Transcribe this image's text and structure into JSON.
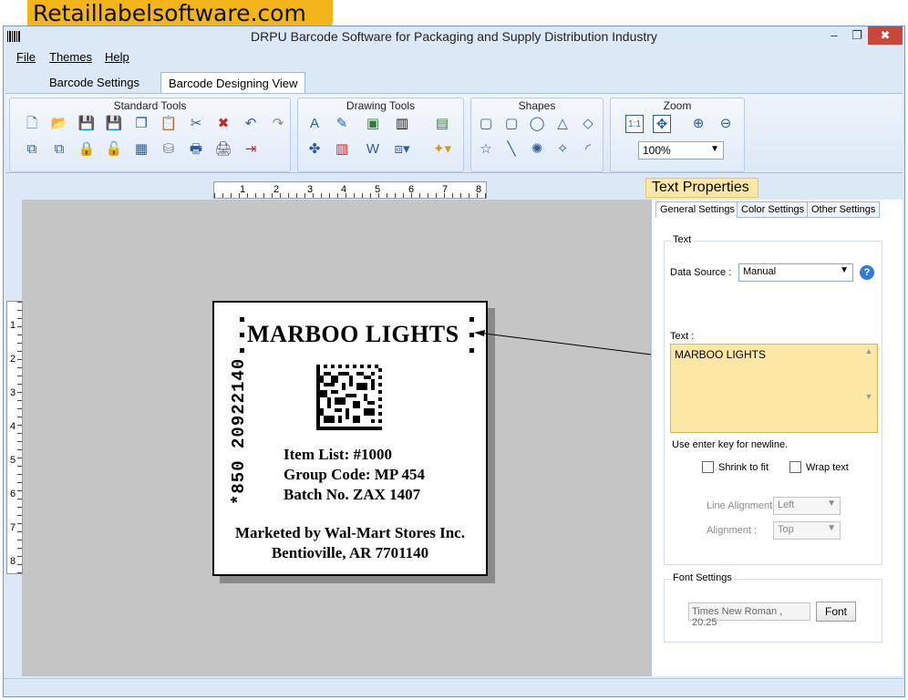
{
  "banner": "Retaillabelsoftware.com",
  "window": {
    "title": "DRPU Barcode Software for Packaging and Supply Distribution Industry",
    "min": "–",
    "max": "❐",
    "close": "✖"
  },
  "menu": [
    "File",
    "Themes",
    "Help"
  ],
  "ribbon_tabs": [
    "Barcode Settings",
    "Barcode Designing View"
  ],
  "ribbon_groups": {
    "standard": "Standard Tools",
    "drawing": "Drawing Tools",
    "shapes": "Shapes",
    "zoom": "Zoom"
  },
  "zoom": {
    "value": "100%",
    "ratio": "1:1"
  },
  "ruler": {
    "h": [
      "1",
      "2",
      "3",
      "4",
      "5",
      "6",
      "7",
      "8"
    ],
    "v": [
      "1",
      "2",
      "3",
      "4",
      "5",
      "6",
      "7",
      "8"
    ]
  },
  "label": {
    "title": "MARBOO LIGHTS",
    "vertical_code": "*850 20922140",
    "lines": [
      "Item List: #1000",
      "Group Code:  MP 454",
      "Batch No. ZAX 1407"
    ],
    "footer": [
      "Marketed by Wal-Mart Stores Inc.",
      "Bentioville, AR 7701140"
    ]
  },
  "panel": {
    "title": "Text Properties",
    "tabs": [
      "General Settings",
      "Color Settings",
      "Other Settings"
    ],
    "text_group": "Text",
    "data_source_label": "Data Source :",
    "data_source_value": "Manual",
    "help": "?",
    "text_label": "Text :",
    "text_value": "MARBOO LIGHTS",
    "hint": "Use enter key for newline.",
    "shrink": "Shrink to fit",
    "wrap": "Wrap text",
    "line_align_label": "Line Alignment",
    "line_align_value": "Left",
    "align_label": "Alignment :",
    "align_value": "Top",
    "font_group": "Font Settings",
    "font_value": "Times New Roman , 20.25",
    "font_button": "Font"
  }
}
